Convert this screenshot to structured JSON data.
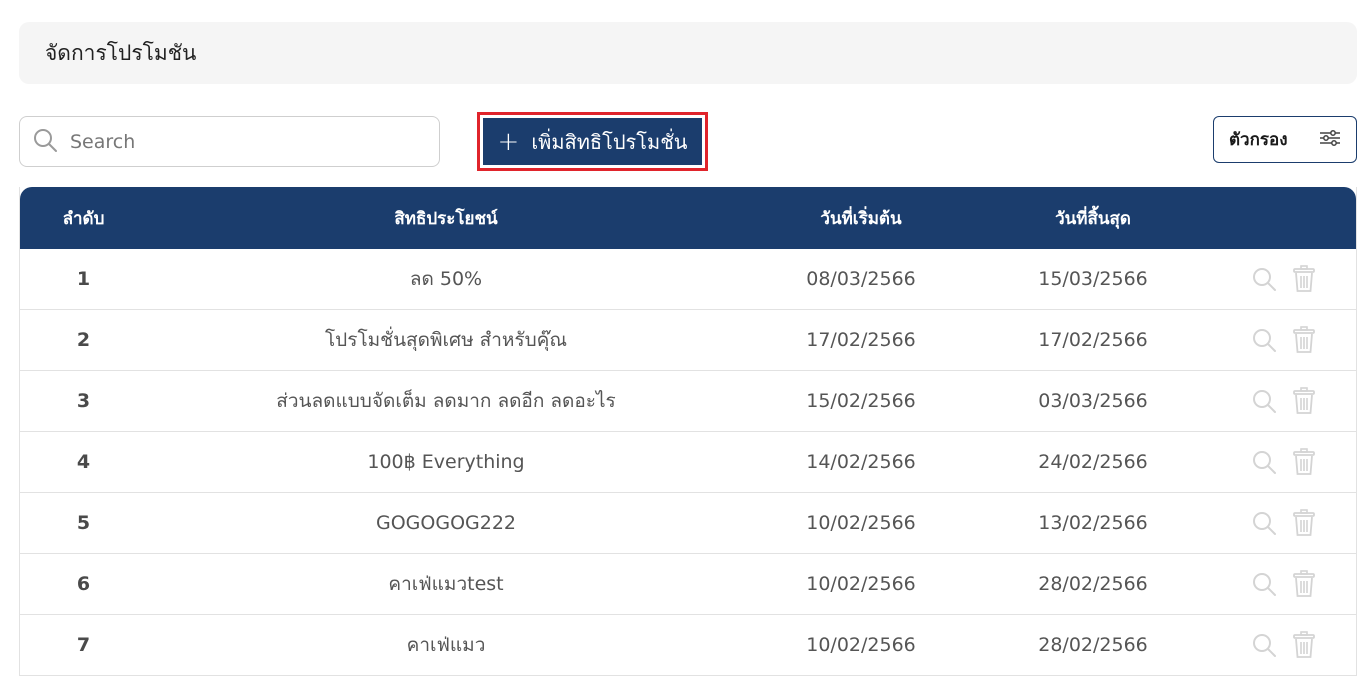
{
  "header": {
    "title": "จัดการโปรโมชัน"
  },
  "search": {
    "placeholder": "Search",
    "icon": "search-icon"
  },
  "add_button": {
    "icon": "plus-icon",
    "label": "เพิ่มสิทธิโปรโมชั่น"
  },
  "filter_button": {
    "label": "ตัวกรอง",
    "icon": "sliders-icon"
  },
  "colors": {
    "primary": "#1b3d6d",
    "highlight": "#e0242b",
    "muted_icon": "#d4d4d4"
  },
  "table": {
    "columns": [
      "ลำดับ",
      "สิทธิประโยชน์",
      "วันที่เริ่มต้น",
      "วันที่สิ้นสุด",
      ""
    ],
    "rows": [
      {
        "index": "1",
        "name": "ลด 50%",
        "start": "08/03/2566",
        "end": "15/03/2566"
      },
      {
        "index": "2",
        "name": "โปรโมชั่นสุดพิเศษ สำหรับคุ๊ณ",
        "start": "17/02/2566",
        "end": "17/02/2566"
      },
      {
        "index": "3",
        "name": "ส่วนลดแบบจัดเต็ม ลดมาก ลดอีก ลดอะไร",
        "start": "15/02/2566",
        "end": "03/03/2566"
      },
      {
        "index": "4",
        "name": "100฿ Everything",
        "start": "14/02/2566",
        "end": "24/02/2566"
      },
      {
        "index": "5",
        "name": "GOGOGOG222",
        "start": "10/02/2566",
        "end": "13/02/2566"
      },
      {
        "index": "6",
        "name": "คาเฟ่แมวtest",
        "start": "10/02/2566",
        "end": "28/02/2566"
      },
      {
        "index": "7",
        "name": "คาเฟ่แมว",
        "start": "10/02/2566",
        "end": "28/02/2566"
      }
    ],
    "row_actions": [
      "view-icon",
      "trash-icon"
    ]
  }
}
